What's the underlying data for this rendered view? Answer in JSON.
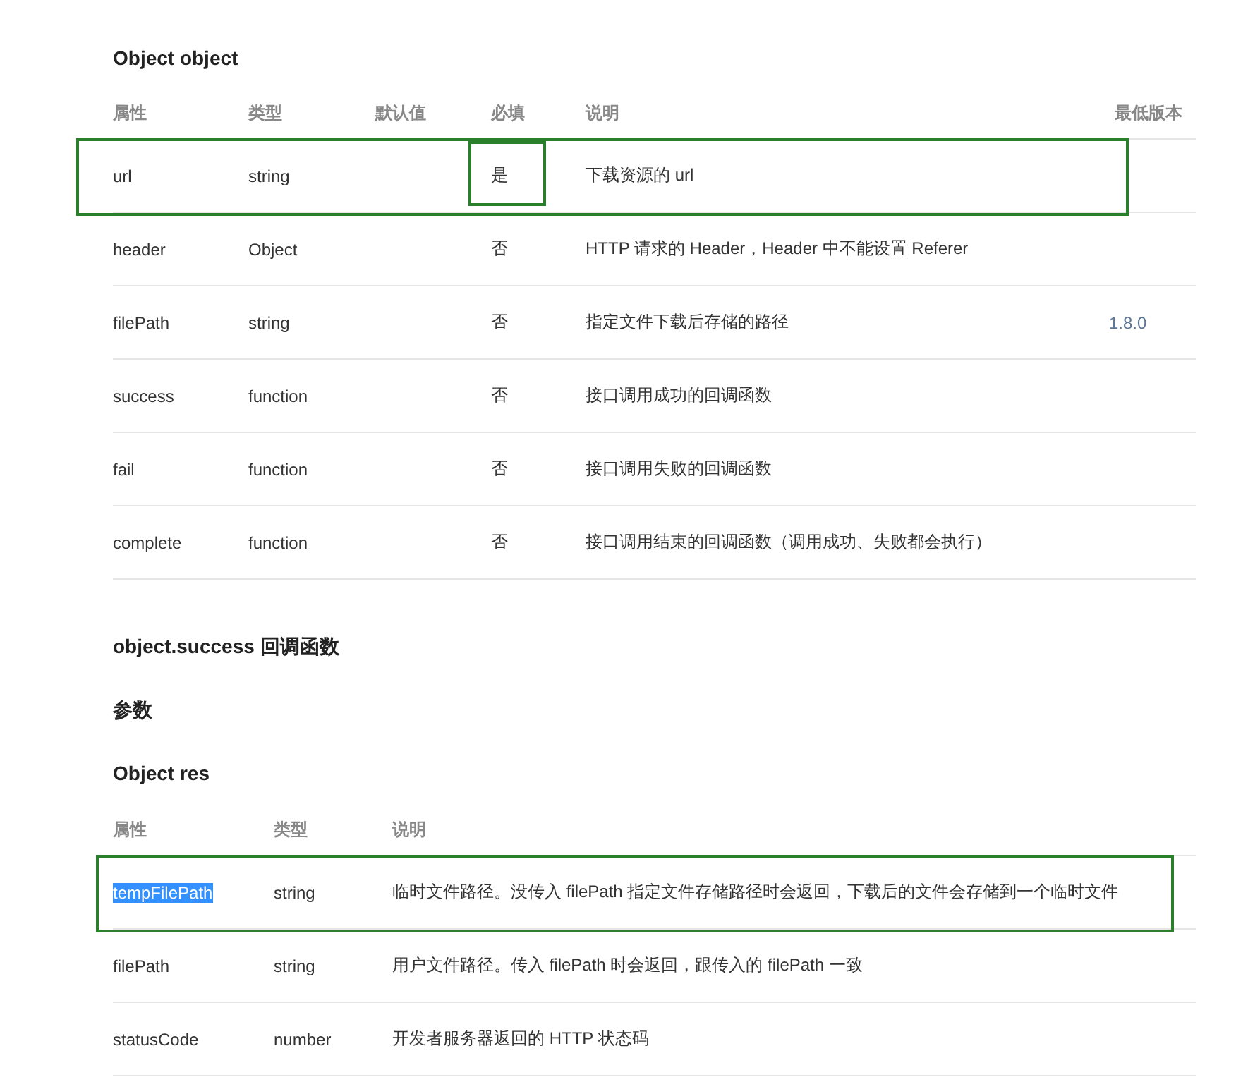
{
  "sections": [
    {
      "kind": "table",
      "title": "Object object",
      "columns": [
        "属性",
        "类型",
        "默认值",
        "必填",
        "说明",
        "最低版本"
      ],
      "rows": [
        {
          "name": {
            "text": "url",
            "selected": false
          },
          "type": "string",
          "default": "",
          "required": {
            "text": "是",
            "highlighted": true
          },
          "description": "下载资源的 url",
          "version": "",
          "highlighted": true
        },
        {
          "name": {
            "text": "header",
            "selected": false
          },
          "type": "Object",
          "default": "",
          "required": {
            "text": "否",
            "highlighted": false
          },
          "description": "HTTP 请求的 Header，Header 中不能设置 Referer",
          "version": "",
          "highlighted": false
        },
        {
          "name": {
            "text": "filePath",
            "selected": false
          },
          "type": "string",
          "default": "",
          "required": {
            "text": "否",
            "highlighted": false
          },
          "description": "指定文件下载后存储的路径",
          "version": "1.8.0",
          "highlighted": false
        },
        {
          "name": {
            "text": "success",
            "selected": false
          },
          "type": "function",
          "default": "",
          "required": {
            "text": "否",
            "highlighted": false
          },
          "description": "接口调用成功的回调函数",
          "version": "",
          "highlighted": false
        },
        {
          "name": {
            "text": "fail",
            "selected": false
          },
          "type": "function",
          "default": "",
          "required": {
            "text": "否",
            "highlighted": false
          },
          "description": "接口调用失败的回调函数",
          "version": "",
          "highlighted": false
        },
        {
          "name": {
            "text": "complete",
            "selected": false
          },
          "type": "function",
          "default": "",
          "required": {
            "text": "否",
            "highlighted": false
          },
          "description": "接口调用结束的回调函数（调用成功、失败都会执行）",
          "version": "",
          "highlighted": false
        }
      ]
    },
    {
      "kind": "heading",
      "title": "object.success 回调函数"
    },
    {
      "kind": "heading",
      "title": "参数"
    },
    {
      "kind": "table",
      "title": "Object res",
      "columns": [
        "属性",
        "类型",
        "说明"
      ],
      "rows": [
        {
          "name": {
            "text": "tempFilePath",
            "selected": true
          },
          "type": "string",
          "description": "临时文件路径。没传入 filePath 指定文件存储路径时会返回，下载后的文件会存储到一个临时文件",
          "highlighted": true
        },
        {
          "name": {
            "text": "filePath",
            "selected": false
          },
          "type": "string",
          "description": "用户文件路径。传入 filePath 时会返回，跟传入的 filePath 一致",
          "highlighted": false
        },
        {
          "name": {
            "text": "statusCode",
            "selected": false
          },
          "type": "number",
          "description": "开发者服务器返回的 HTTP 状态码",
          "highlighted": false
        }
      ]
    }
  ]
}
